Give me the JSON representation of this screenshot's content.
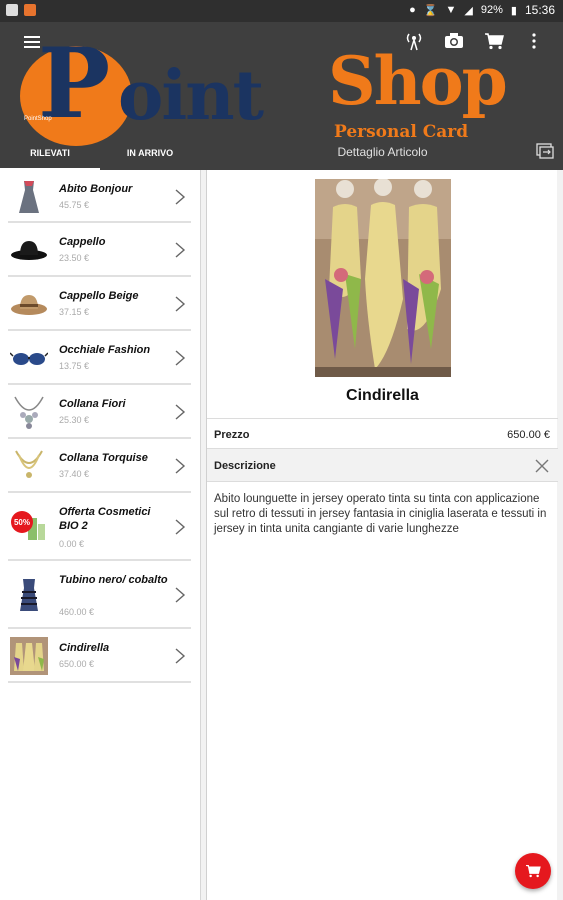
{
  "statusbar": {
    "battery": "92%",
    "time": "15:36",
    "icons": [
      "location-icon",
      "bluetooth-icon",
      "wifi-icon",
      "signal-icon",
      "battery-icon"
    ]
  },
  "appbar": {
    "logo": {
      "brand_p": "P",
      "brand_oint": "oint",
      "brand_shop": "Shop",
      "subtitle": "Personal Card",
      "tiny": "PointShop"
    },
    "actions": [
      "nfc-icon",
      "camera-icon",
      "cart-icon",
      "more-vert-icon"
    ],
    "tabs": [
      {
        "label": "RILEVATI",
        "active": true
      },
      {
        "label": "IN ARRIVO",
        "active": false
      }
    ],
    "detail_title": "Dettaglio Articolo"
  },
  "products": [
    {
      "name": "Abito Bonjour",
      "price": "45.75 €",
      "icon": "dress-icon"
    },
    {
      "name": "Cappello",
      "price": "23.50 €",
      "icon": "hat-icon"
    },
    {
      "name": "Cappello Beige",
      "price": "37.15 €",
      "icon": "beige-hat-icon"
    },
    {
      "name": "Occhiale Fashion",
      "price": "13.75 €",
      "icon": "glasses-icon"
    },
    {
      "name": "Collana Fiori",
      "price": "25.30 €",
      "icon": "necklace-icon"
    },
    {
      "name": "Collana Torquise",
      "price": "37.40 €",
      "icon": "necklace-gold-icon"
    },
    {
      "name": "Offerta Cosmetici BIO 2",
      "price": "0.00 €",
      "icon": "cosmetics-offer-icon",
      "badge": "50%"
    },
    {
      "name": "Tubino nero/ cobalto",
      "price": "460.00 €",
      "icon": "dress-striped-icon"
    },
    {
      "name": "Cindirella",
      "price": "650.00 €",
      "icon": "dress-gown-icon"
    }
  ],
  "detail": {
    "name": "Cindirella",
    "price_label": "Prezzo",
    "price_value": "650.00 €",
    "desc_label": "Descrizione",
    "description": "Abito lounguette in jersey operato tinta su tinta con applicazione sul retro di tessuti in jersey fantasia in ciniglia laserata e tessuti in jersey in tinta unita cangiante di varie lunghezze"
  },
  "colors": {
    "appbar": "#3f3f3f",
    "brand_orange": "#f07a1a",
    "brand_navy": "#1b3461",
    "fab": "#e5181e"
  }
}
